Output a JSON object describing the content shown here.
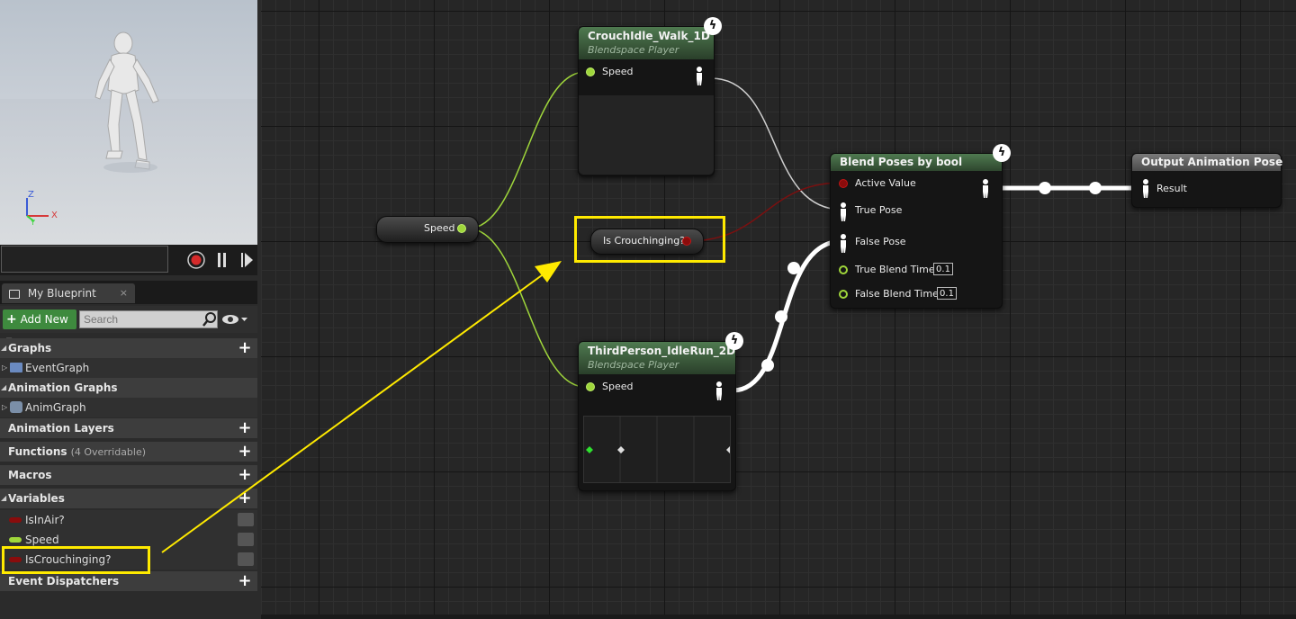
{
  "viewport": {
    "axis_z": "Z",
    "axis_y": "Y",
    "axis_x": "X"
  },
  "blueprint_panel": {
    "tab_label": "My Blueprint",
    "add_new_label": "Add New",
    "search_placeholder": "Search",
    "sections": {
      "graphs": "Graphs",
      "event_graph": "EventGraph",
      "animation_graphs": "Animation Graphs",
      "anim_graph": "AnimGraph",
      "animation_layers": "Animation Layers",
      "functions": "Functions",
      "functions_count": "(4 Overridable)",
      "macros": "Macros",
      "variables": "Variables",
      "event_dispatchers": "Event Dispatchers"
    },
    "variables": [
      {
        "name": "IsInAir?",
        "color": "#8a0c0c"
      },
      {
        "name": "Speed",
        "color": "#9fd63b"
      },
      {
        "name": "IsCrouchinging?",
        "color": "#8a0c0c"
      }
    ]
  },
  "graph": {
    "nodes": {
      "crouch": {
        "title": "CrouchIdle_Walk_1D",
        "subtitle": "Blendspace Player",
        "pin_speed": "Speed"
      },
      "thirdperson": {
        "title": "ThirdPerson_IdleRun_2D",
        "subtitle": "Blendspace Player",
        "pin_speed": "Speed"
      },
      "speed_var": {
        "label": "Speed"
      },
      "crouch_var": {
        "label": "Is Crouchinging?"
      },
      "blend": {
        "title": "Blend Poses by bool",
        "active_value": "Active Value",
        "true_pose": "True Pose",
        "false_pose": "False Pose",
        "true_blend_time": "True Blend Time",
        "true_blend_value": "0.1",
        "false_blend_time": "False Blend Time",
        "false_blend_value": "0.1"
      },
      "output": {
        "title": "Output Animation Pose",
        "result": "Result"
      }
    }
  },
  "colors": {
    "highlight": "#ffea00",
    "float_pin": "#9fd63b",
    "bool_pin": "#8a0c0c",
    "anim_node_header": "#4f7a50",
    "output_header": "#6e6e6e"
  }
}
